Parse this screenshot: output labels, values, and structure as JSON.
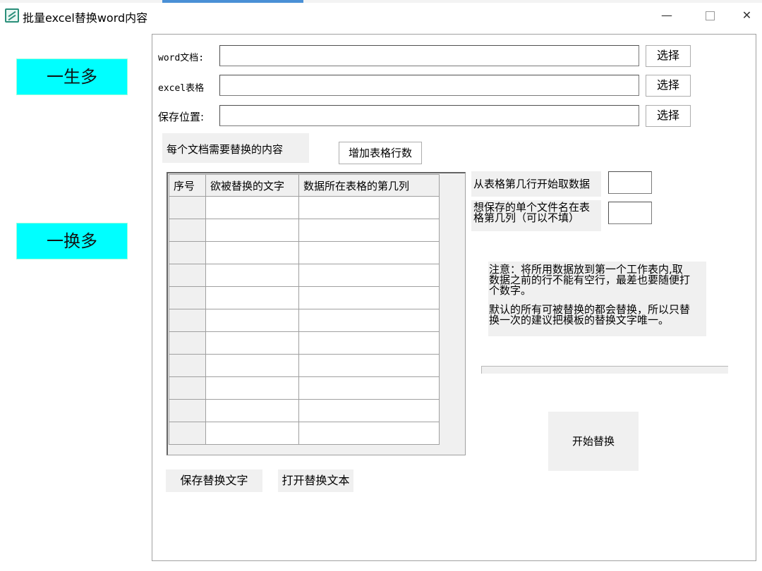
{
  "window": {
    "title": "批量excel替换word内容",
    "minimize": "—",
    "close": "✕"
  },
  "sidebar": {
    "one_to_many": "一生多",
    "replace_many": "一换多"
  },
  "form": {
    "word_label": "word文档:",
    "excel_label": "excel表格",
    "save_label": "保存位置:",
    "word_value": "",
    "excel_value": "",
    "save_value": "",
    "browse": "选择"
  },
  "replace": {
    "heading": "每个文档需要替换的内容",
    "add_rows": "增加表格行数",
    "columns": [
      "序号",
      "欲被替换的文字",
      "数据所在表格的第几列"
    ],
    "row_count": 11
  },
  "options": {
    "start_row_label": "从表格第几行开始取数据",
    "start_row_value": "",
    "filename_col_label_1": "想保存的单个文件名在表",
    "filename_col_label_2": "格第几列（可以不填）",
    "filename_col_value": ""
  },
  "notes": {
    "line1": "注意：将所用数据放到第一个工作表内,取",
    "line2": "数据之前的行不能有空行，最差也要随便打",
    "line3": "个数字。",
    "line4": "默认的所有可被替换的都会替换，所以只替",
    "line5": "换一次的建议把模板的替换文字唯一。"
  },
  "progress": {
    "value": 0
  },
  "actions": {
    "start": "开始替换",
    "save_text": "保存替换文字",
    "open_text": "打开替换文本"
  }
}
